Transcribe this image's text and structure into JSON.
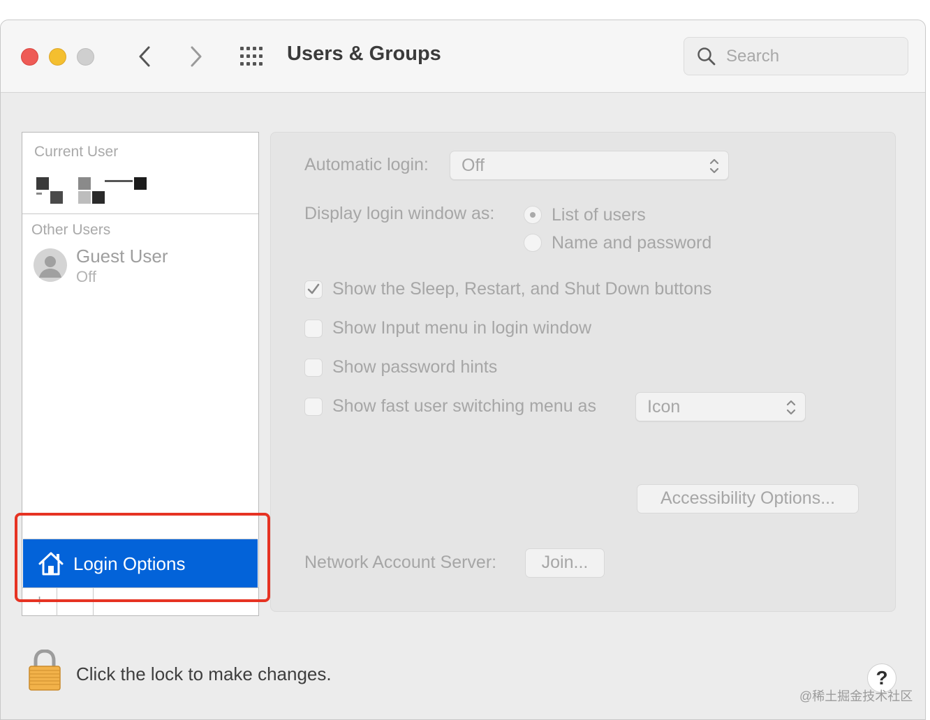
{
  "window": {
    "title": "Users & Groups",
    "search_placeholder": "Search"
  },
  "sidebar": {
    "current_user_label": "Current User",
    "other_users_label": "Other Users",
    "guest": {
      "name": "Guest User",
      "status": "Off"
    },
    "login_options_label": "Login Options",
    "add_symbol": "+"
  },
  "panel": {
    "automatic_login_label": "Automatic login:",
    "automatic_login_value": "Off",
    "display_login_label": "Display login window as:",
    "radio_list_label": "List of users",
    "radio_name_label": "Name and password",
    "radio_selected": "List of users",
    "checkboxes": [
      {
        "label": "Show the Sleep, Restart, and Shut Down buttons",
        "checked": true
      },
      {
        "label": "Show Input menu in login window",
        "checked": false
      },
      {
        "label": "Show password hints",
        "checked": false
      },
      {
        "label": "Show fast user switching menu as",
        "checked": false
      }
    ],
    "fast_switch_value": "Icon",
    "accessibility_button": "Accessibility Options...",
    "network_label": "Network Account Server:",
    "join_button": "Join..."
  },
  "footer": {
    "lock_text": "Click the lock to make changes.",
    "help_symbol": "?"
  },
  "watermark": "@稀土掘金技术社区",
  "colors": {
    "selection_blue": "#0363d9",
    "highlight_red": "#e63323",
    "close": "#ee5b56",
    "minimize": "#f4bf2f"
  },
  "icons": [
    "close-button",
    "minimize-button",
    "zoom-button",
    "chevron-left-icon",
    "chevron-right-icon",
    "grid-icon",
    "search-icon",
    "house-icon",
    "user-silhouette-icon",
    "popup-arrows-icon",
    "checkmark-icon",
    "lock-icon"
  ]
}
